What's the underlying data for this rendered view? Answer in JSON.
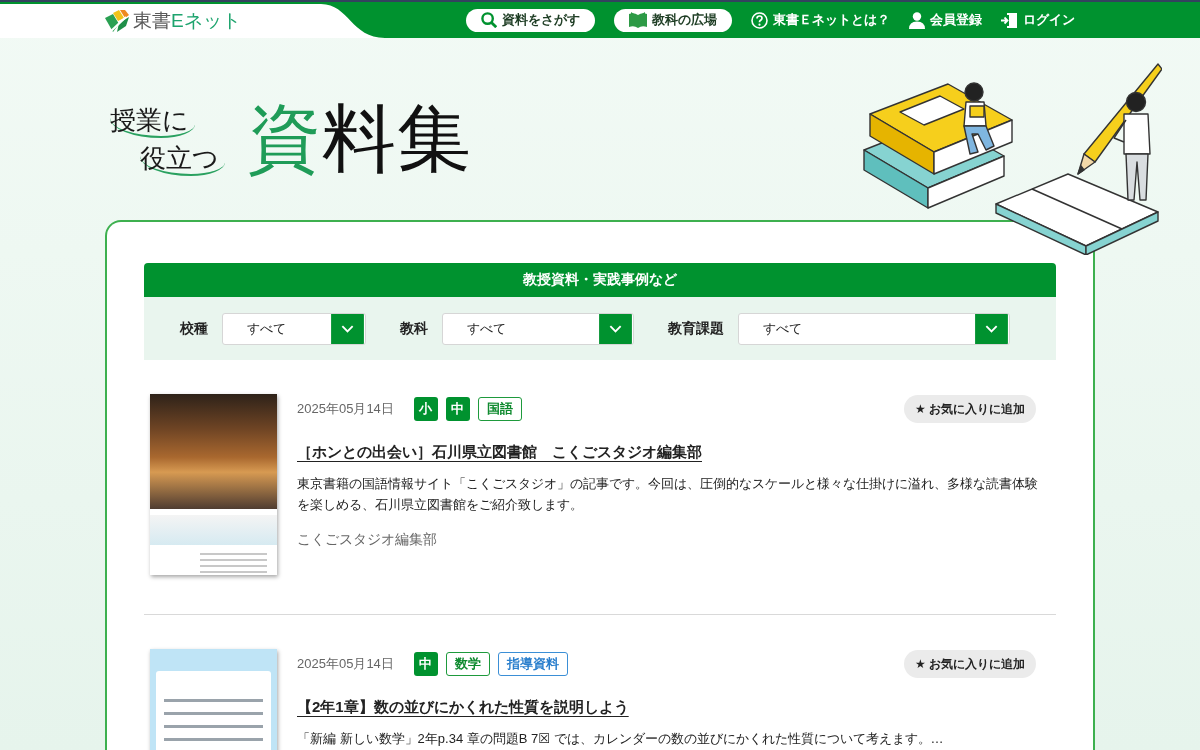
{
  "header": {
    "logo": {
      "text": [
        "東書",
        "Eネット"
      ]
    },
    "nav": [
      {
        "kind": "pill",
        "label": "資料をさがす"
      },
      {
        "kind": "pill",
        "label": "教科の広場"
      },
      {
        "kind": "link",
        "label": "東書Ｅネットとは？"
      },
      {
        "kind": "link",
        "label": "会員登録"
      },
      {
        "kind": "link",
        "label": "ログイン"
      }
    ]
  },
  "hero": {
    "title_lead": [
      "授業に",
      "役立つ"
    ],
    "title_main": "資料集"
  },
  "filter_panel": {
    "heading": "教授資料・実践事例など",
    "filters": [
      {
        "label": "校種",
        "value": "すべて"
      },
      {
        "label": "教科",
        "value": "すべて"
      },
      {
        "label": "教育課題",
        "value": "すべて"
      }
    ]
  },
  "results": [
    {
      "thumbnail": {
        "kind": "cover"
      },
      "date": "2025年05月14日",
      "tags": [
        {
          "kind": "grade",
          "label": "小"
        },
        {
          "kind": "grade",
          "label": "中"
        },
        {
          "kind": "subject",
          "label": "国語"
        }
      ],
      "favorite_button": "★ お気に入りに追加",
      "title": "［ホンとの出会い］石川県立図書館　こくごスタジオ編集部",
      "description": "東京書籍の国語情報サイト「こくごスタジオ」の記事です。今回は、圧倒的なスケールと様々な仕掛けに溢れ、多様な読書体験を楽しめる、石川県立図書館をご紹介致します。",
      "author": "こくごスタジオ編集部"
    },
    {
      "thumbnail": {
        "kind": "screenshot"
      },
      "date": "2025年05月14日",
      "tags": [
        {
          "kind": "grade",
          "label": "中"
        },
        {
          "kind": "subject",
          "label": "数学"
        },
        {
          "kind": "material",
          "label": "指導資料"
        }
      ],
      "favorite_button": "★ お気に入りに追加",
      "title": "【2年1章】数の並びにかくれた性質を説明しよう",
      "description": "「新編 新しい数学」2年p.34 章の問題B 7☒ では、カレンダーの数の並びにかくれた性質について考えます。…"
    }
  ]
}
